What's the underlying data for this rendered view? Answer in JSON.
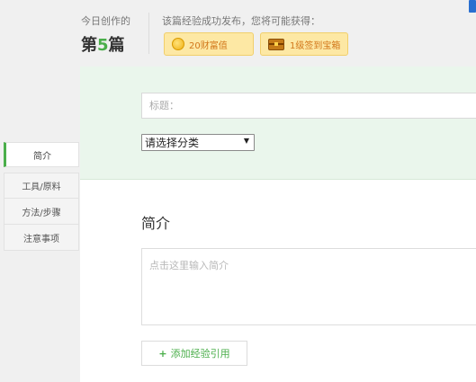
{
  "header": {
    "today_label": "今日创作的",
    "count_prefix": "第",
    "count_number": "5",
    "count_suffix": "篇",
    "publish_message": "该篇经验成功发布，您将可能获得：",
    "rewards": [
      {
        "icon": "coin-icon",
        "label": "20财富值"
      },
      {
        "icon": "treasure-chest-icon",
        "label": "1级签到宝箱"
      }
    ]
  },
  "editor": {
    "title_placeholder": "标题：",
    "category_selected": "请选择分类",
    "intro_heading": "简介",
    "intro_placeholder": "点击这里输入简介",
    "add_reference_label": "添加经验引用"
  },
  "sidebar": {
    "tabs": [
      {
        "label": "简介",
        "active": true
      },
      {
        "label": "工具/原料",
        "active": false
      },
      {
        "label": "方法/步骤",
        "active": false
      },
      {
        "label": "注意事项",
        "active": false
      }
    ]
  },
  "colors": {
    "accent": "#4aae4a",
    "title_area_bg": "#eaf6ec",
    "reward_bg": "#fde8a4",
    "reward_text": "#d2771a"
  }
}
